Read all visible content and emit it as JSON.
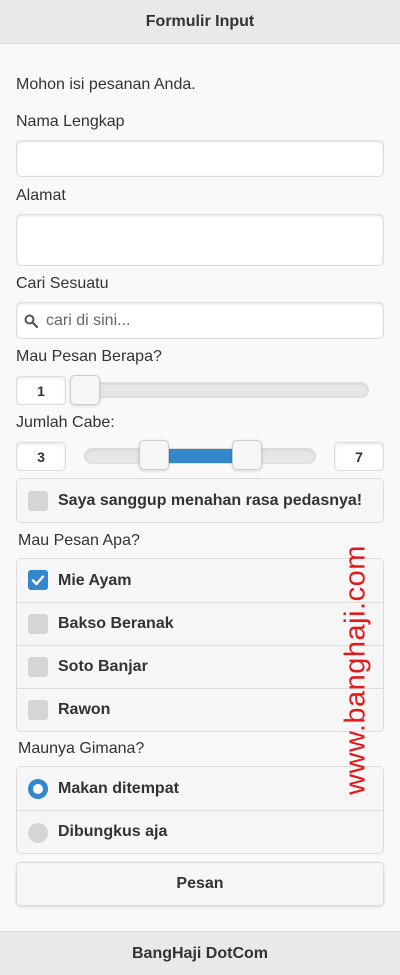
{
  "header": {
    "title": "Formulir Input"
  },
  "form": {
    "intro": "Mohon isi pesanan Anda.",
    "name_label": "Nama Lengkap",
    "name_value": "",
    "address_label": "Alamat",
    "address_value": "",
    "search_label": "Cari Sesuatu",
    "search_placeholder": "cari di sini...",
    "quantity": {
      "label": "Mau Pesan Berapa?",
      "value": "1",
      "min": 1,
      "max": 100
    },
    "chili": {
      "label": "Jumlah Cabe:",
      "low": "3",
      "high": "7",
      "min": 0,
      "max": 10
    },
    "spicy_toggle": {
      "label": "Saya sanggup menahan rasa pedasnya!",
      "checked": false
    },
    "menu": {
      "label": "Mau Pesan Apa?",
      "items": [
        {
          "label": "Mie Ayam",
          "checked": true
        },
        {
          "label": "Bakso Beranak",
          "checked": false
        },
        {
          "label": "Soto Banjar",
          "checked": false
        },
        {
          "label": "Rawon",
          "checked": false
        }
      ]
    },
    "service": {
      "label": "Maunya Gimana?",
      "options": [
        {
          "label": "Makan ditempat",
          "selected": true
        },
        {
          "label": "Dibungkus aja",
          "selected": false
        }
      ]
    },
    "submit_label": "Pesan"
  },
  "watermark": "www.banghaji.com",
  "footer": {
    "title": "BangHaji DotCom"
  },
  "colors": {
    "accent": "#3388cc",
    "watermark": "#e01b1b"
  },
  "icons": [
    "search-icon",
    "check-icon"
  ]
}
